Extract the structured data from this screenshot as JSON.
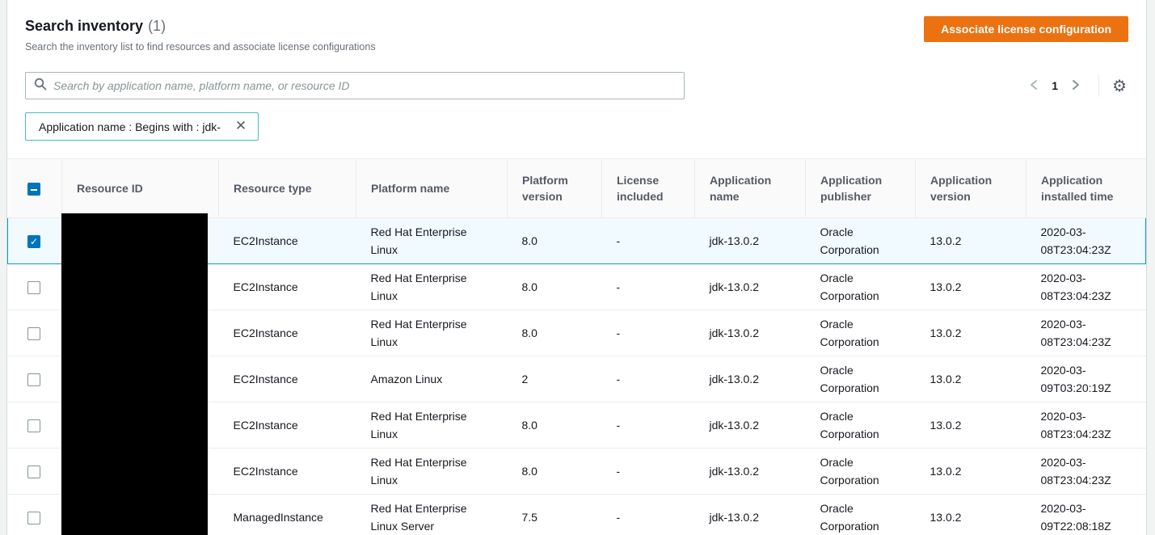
{
  "page": {
    "background": "#f2f3f3",
    "panel_background": "#ffffff"
  },
  "header": {
    "title": "Search inventory",
    "count": "(1)",
    "subtitle": "Search the inventory list to find resources and associate license configurations",
    "action_button": "Associate license configuration",
    "button_color": "#ec7211"
  },
  "toolbar": {
    "search": {
      "placeholder": "Search by application name, platform name, or resource ID",
      "value": "",
      "icon": "magnifier-icon"
    },
    "pagination": {
      "current_page": "1",
      "prev_icon": "chevron-left",
      "next_icon": "chevron-right"
    },
    "settings_icon": "gear-icon",
    "gear_glyph": "⚙"
  },
  "filter_tag": {
    "text": "Application name : Begins with : jdk-",
    "close_icon": "x-icon",
    "close_glyph": "✕",
    "border_color": "#44b9d6"
  },
  "table": {
    "select_all_state": "indeterminate",
    "selected_row_index": 0,
    "selected_row_bg": "#f1faff",
    "selected_row_border": "#00a1c9",
    "redaction": {
      "column": "Resource ID",
      "color": "#000000"
    },
    "columns": [
      "Resource ID",
      "Resource type",
      "Platform name",
      "Platform version",
      "License included",
      "Application name",
      "Application publisher",
      "Application version",
      "Application installed time"
    ],
    "rows": [
      {
        "selected": true,
        "resource_id": "",
        "resource_type": "EC2Instance",
        "platform_name": "Red Hat Enterprise Linux",
        "platform_version": "8.0",
        "license_included": "-",
        "application_name": "jdk-13.0.2",
        "application_publisher": "Oracle Corporation",
        "application_version": "13.0.2",
        "application_installed_time": "2020-03-08T23:04:23Z"
      },
      {
        "selected": false,
        "resource_id": "",
        "resource_type": "EC2Instance",
        "platform_name": "Red Hat Enterprise Linux",
        "platform_version": "8.0",
        "license_included": "-",
        "application_name": "jdk-13.0.2",
        "application_publisher": "Oracle Corporation",
        "application_version": "13.0.2",
        "application_installed_time": "2020-03-08T23:04:23Z"
      },
      {
        "selected": false,
        "resource_id": "",
        "resource_type": "EC2Instance",
        "platform_name": "Red Hat Enterprise Linux",
        "platform_version": "8.0",
        "license_included": "-",
        "application_name": "jdk-13.0.2",
        "application_publisher": "Oracle Corporation",
        "application_version": "13.0.2",
        "application_installed_time": "2020-03-08T23:04:23Z"
      },
      {
        "selected": false,
        "resource_id": "",
        "resource_type": "EC2Instance",
        "platform_name": "Amazon Linux",
        "platform_version": "2",
        "license_included": "-",
        "application_name": "jdk-13.0.2",
        "application_publisher": "Oracle Corporation",
        "application_version": "13.0.2",
        "application_installed_time": "2020-03-09T03:20:19Z"
      },
      {
        "selected": false,
        "resource_id": "",
        "resource_type": "EC2Instance",
        "platform_name": "Red Hat Enterprise Linux",
        "platform_version": "8.0",
        "license_included": "-",
        "application_name": "jdk-13.0.2",
        "application_publisher": "Oracle Corporation",
        "application_version": "13.0.2",
        "application_installed_time": "2020-03-08T23:04:23Z"
      },
      {
        "selected": false,
        "resource_id": "",
        "resource_type": "EC2Instance",
        "platform_name": "Red Hat Enterprise Linux",
        "platform_version": "8.0",
        "license_included": "-",
        "application_name": "jdk-13.0.2",
        "application_publisher": "Oracle Corporation",
        "application_version": "13.0.2",
        "application_installed_time": "2020-03-08T23:04:23Z"
      },
      {
        "selected": false,
        "resource_id": "",
        "resource_type": "ManagedInstance",
        "platform_name": "Red Hat Enterprise Linux Server",
        "platform_version": "7.5",
        "license_included": "-",
        "application_name": "jdk-13.0.2",
        "application_publisher": "Oracle Corporation",
        "application_version": "13.0.2",
        "application_installed_time": "2020-03-09T22:08:18Z"
      }
    ]
  }
}
